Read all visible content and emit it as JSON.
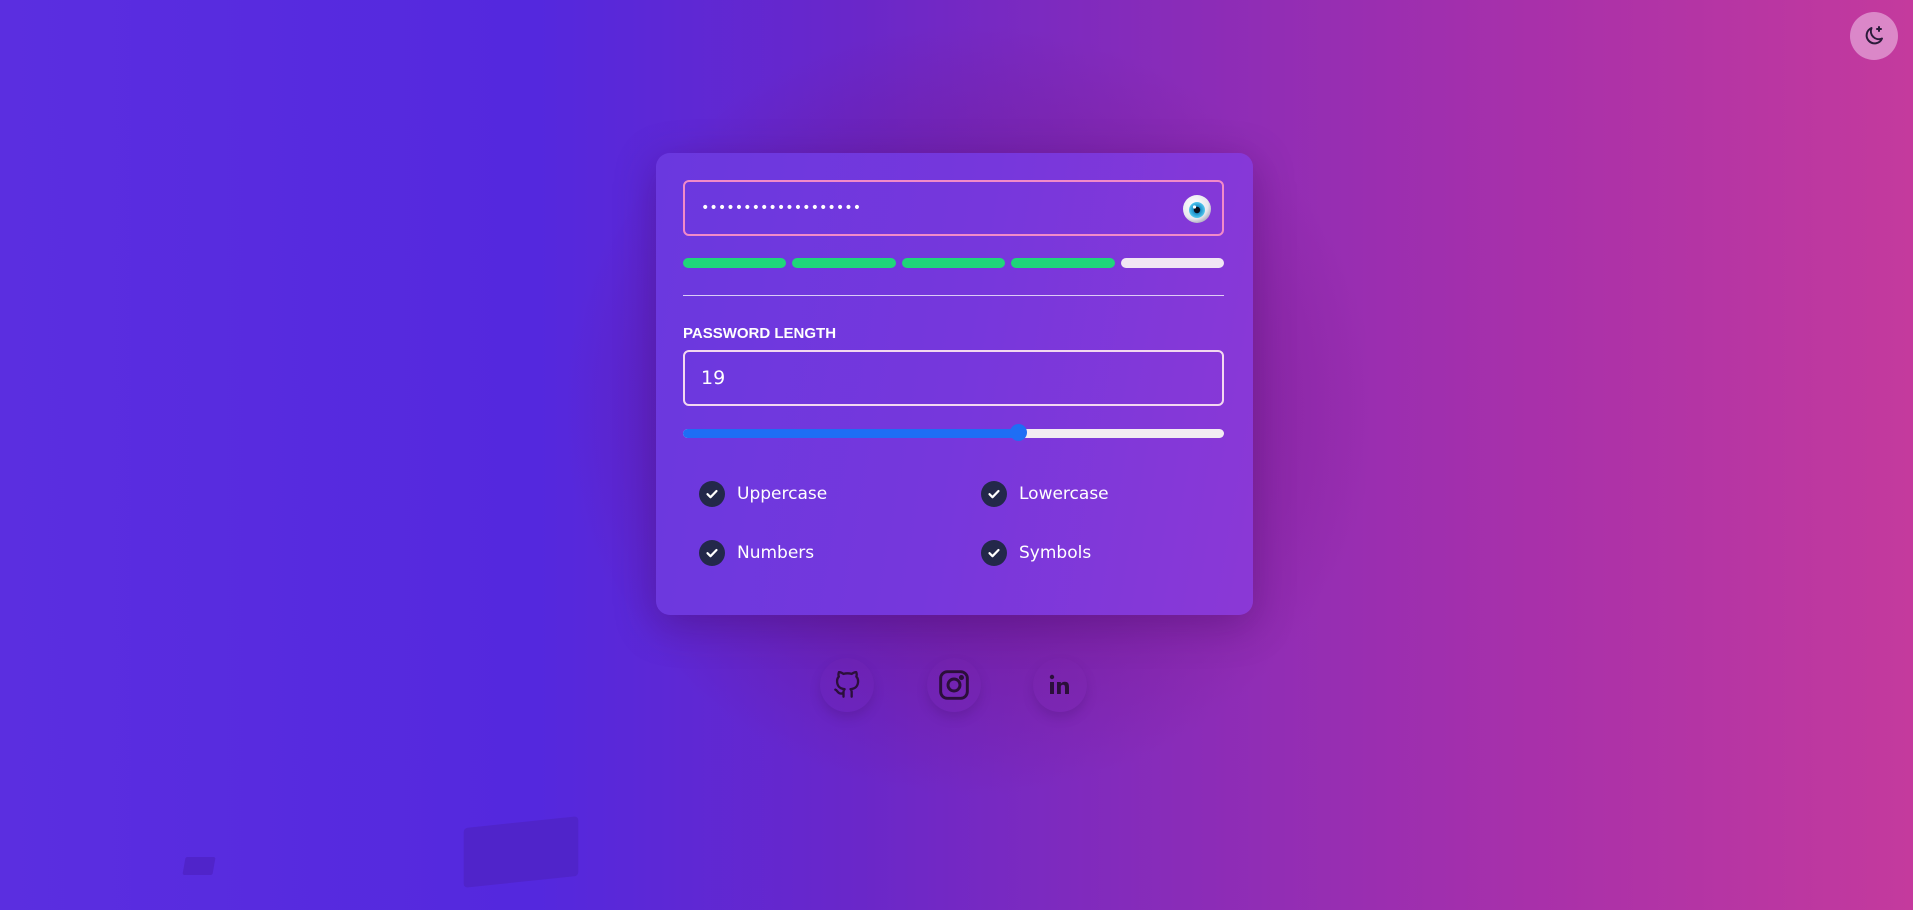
{
  "theme_toggle": {
    "icon": "moon-star-icon"
  },
  "password": {
    "value": "•••••••••••••••••••",
    "reveal_icon": "eye-icon"
  },
  "strength": {
    "filled_segments": 4,
    "total_segments": 5,
    "filled_color": "#1fd67a"
  },
  "length": {
    "label": "PASSWORD LENGTH",
    "value": "19",
    "slider_fraction": 0.62
  },
  "options": {
    "uppercase": {
      "label": "Uppercase",
      "checked": true
    },
    "lowercase": {
      "label": "Lowercase",
      "checked": true
    },
    "numbers": {
      "label": "Numbers",
      "checked": true
    },
    "symbols": {
      "label": "Symbols",
      "checked": true
    }
  },
  "social": {
    "github": {
      "icon": "github-icon"
    },
    "instagram": {
      "icon": "instagram-icon"
    },
    "linkedin": {
      "icon": "linkedin-icon"
    }
  },
  "colors": {
    "slider_accent": "#1e6ef5",
    "field_border": "#f28ac8"
  }
}
